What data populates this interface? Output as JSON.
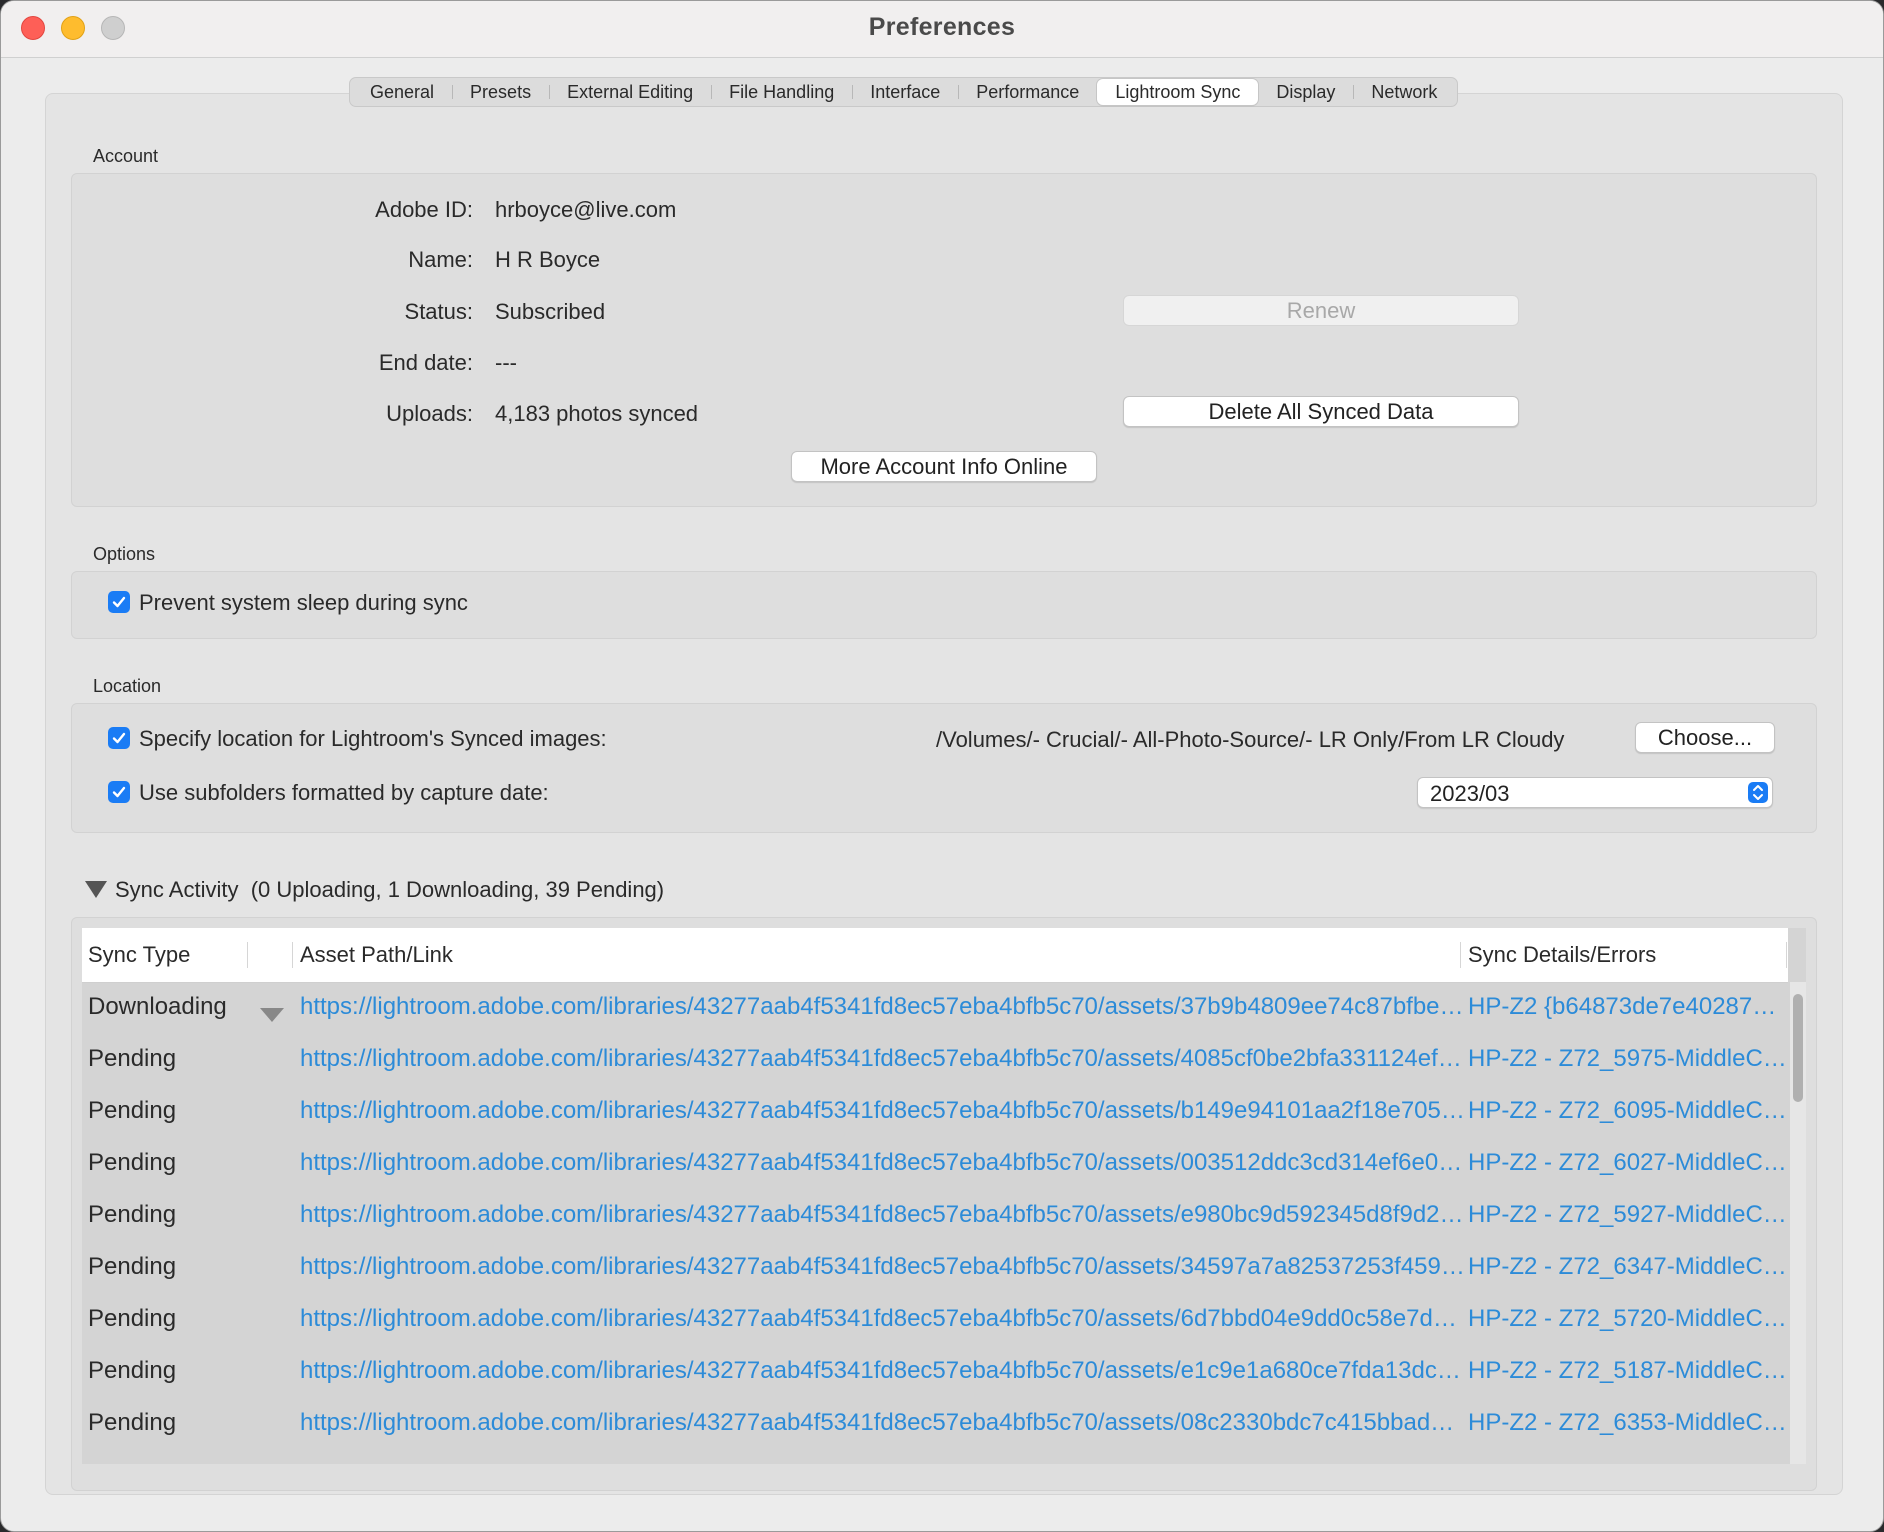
{
  "window": {
    "title": "Preferences"
  },
  "tabs": [
    {
      "label": "General"
    },
    {
      "label": "Presets"
    },
    {
      "label": "External Editing"
    },
    {
      "label": "File Handling"
    },
    {
      "label": "Interface"
    },
    {
      "label": "Performance"
    },
    {
      "label": "Lightroom Sync",
      "active": true
    },
    {
      "label": "Display"
    },
    {
      "label": "Network"
    }
  ],
  "account": {
    "section_label": "Account",
    "adobe_id_label": "Adobe ID:",
    "adobe_id": "hrboyce@live.com",
    "name_label": "Name:",
    "name": "H R Boyce",
    "status_label": "Status:",
    "status": "Subscribed",
    "end_date_label": "End date:",
    "end_date": "---",
    "uploads_label": "Uploads:",
    "uploads": "4,183 photos synced",
    "renew_button": "Renew",
    "delete_button": "Delete All Synced Data",
    "more_info_button": "More Account Info Online"
  },
  "options": {
    "section_label": "Options",
    "prevent_sleep_label": "Prevent system sleep during sync",
    "prevent_sleep_checked": true
  },
  "location": {
    "section_label": "Location",
    "specify_label": "Specify location for Lightroom's Synced images:",
    "specify_checked": true,
    "path": "/Volumes/- Crucial/- All-Photo-Source/- LR Only/From LR Cloudy",
    "choose_button": "Choose...",
    "subfolders_label": "Use subfolders formatted by capture date:",
    "subfolders_checked": true,
    "date_format": "2023/03"
  },
  "activity": {
    "title": "Sync Activity",
    "summary": "(0 Uploading, 1 Downloading, 39 Pending)",
    "columns": [
      "Sync Type",
      "Asset Path/Link",
      "Sync Details/Errors"
    ],
    "rows": [
      {
        "type": "Downloading",
        "path": "https://lightroom.adobe.com/libraries/43277aab4f5341fd8ec57eba4bfb5c70/assets/37b9b4809ee74c87bfbe163bbf58...",
        "details": "HP-Z2 {b64873de7e4028743a..."
      },
      {
        "type": "Pending",
        "path": "https://lightroom.adobe.com/libraries/43277aab4f5341fd8ec57eba4bfb5c70/assets/4085cf0be2bfa331124ef2a438995...",
        "details": "HP-Z2  - Z72_5975-MiddleCre..."
      },
      {
        "type": "Pending",
        "path": "https://lightroom.adobe.com/libraries/43277aab4f5341fd8ec57eba4bfb5c70/assets/b149e94101aa2f18e7053f8ea7845...",
        "details": "HP-Z2  - Z72_6095-MiddleCr..."
      },
      {
        "type": "Pending",
        "path": "https://lightroom.adobe.com/libraries/43277aab4f5341fd8ec57eba4bfb5c70/assets/003512ddc3cd314ef6e096114c5b...",
        "details": "HP-Z2  - Z72_6027-MiddleCre..."
      },
      {
        "type": "Pending",
        "path": "https://lightroom.adobe.com/libraries/43277aab4f5341fd8ec57eba4bfb5c70/assets/e980bc9d592345d8f9d2db6738c...",
        "details": "HP-Z2  - Z72_5927-MiddleCre..."
      },
      {
        "type": "Pending",
        "path": "https://lightroom.adobe.com/libraries/43277aab4f5341fd8ec57eba4bfb5c70/assets/34597a7a82537253f459e547bce...",
        "details": "HP-Z2  - Z72_6347-MiddleCre..."
      },
      {
        "type": "Pending",
        "path": "https://lightroom.adobe.com/libraries/43277aab4f5341fd8ec57eba4bfb5c70/assets/6d7bbd04e9dd0c58e7db970660...",
        "details": "HP-Z2  - Z72_5720-MiddleCre..."
      },
      {
        "type": "Pending",
        "path": "https://lightroom.adobe.com/libraries/43277aab4f5341fd8ec57eba4bfb5c70/assets/e1c9e1a680ce7fda13dce10568f06...",
        "details": "HP-Z2  - Z72_5187-MiddleCre..."
      },
      {
        "type": "Pending",
        "path": "https://lightroom.adobe.com/libraries/43277aab4f5341fd8ec57eba4bfb5c70/assets/08c2330bdc7c415bbad1dac577c6...",
        "details": "HP-Z2  - Z72_6353-MiddleCre..."
      }
    ]
  },
  "colors": {
    "accent": "#1a7cf5",
    "link": "#2c8bd8"
  }
}
